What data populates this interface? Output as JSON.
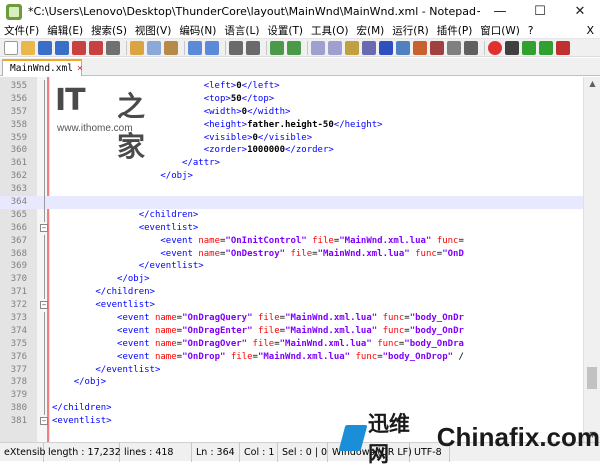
{
  "window": {
    "title": "*C:\\Users\\Lenovo\\Desktop\\ThunderCore\\layout\\MainWnd\\MainWnd.xml - Notepad++",
    "minimize": "—",
    "maximize": "☐",
    "close": "✕"
  },
  "menu": {
    "items": [
      "文件(F)",
      "编辑(E)",
      "搜索(S)",
      "视图(V)",
      "编码(N)",
      "语言(L)",
      "设置(T)",
      "工具(O)",
      "宏(M)",
      "运行(R)",
      "插件(P)",
      "窗口(W)",
      "?"
    ],
    "close": "X"
  },
  "tab": {
    "label": "MainWnd.xml",
    "close": "×"
  },
  "editor": {
    "lines": [
      {
        "n": "355",
        "fold": "",
        "html": "                            <span class=\"tag\">&lt;left&gt;</span><span class=\"txt\">0</span><span class=\"tag\">&lt;/left&gt;</span>"
      },
      {
        "n": "356",
        "fold": "",
        "html": "                            <span class=\"tag\">&lt;top&gt;</span><span class=\"txt\">50</span><span class=\"tag\">&lt;/top&gt;</span>"
      },
      {
        "n": "357",
        "fold": "",
        "html": "                            <span class=\"tag\">&lt;width&gt;</span><span class=\"txt\">0</span><span class=\"tag\">&lt;/width&gt;</span>"
      },
      {
        "n": "358",
        "fold": "",
        "html": "                            <span class=\"tag\">&lt;height&gt;</span><span class=\"txt\">father.height-50</span><span class=\"tag\">&lt;/height&gt;</span>"
      },
      {
        "n": "359",
        "fold": "",
        "html": "                            <span class=\"tag\">&lt;visible&gt;</span><span class=\"txt\">0</span><span class=\"tag\">&lt;/visible&gt;</span>"
      },
      {
        "n": "360",
        "fold": "",
        "html": "                            <span class=\"tag\">&lt;zorder&gt;</span><span class=\"txt\">1000000</span><span class=\"tag\">&lt;/zorder&gt;</span>"
      },
      {
        "n": "361",
        "fold": "",
        "html": "                        <span class=\"tag\">&lt;/attr&gt;</span>"
      },
      {
        "n": "362",
        "fold": "",
        "html": "                    <span class=\"tag\">&lt;/obj&gt;</span>"
      },
      {
        "n": "363",
        "fold": "",
        "html": ""
      },
      {
        "n": "364",
        "fold": "",
        "html": "",
        "current": true
      },
      {
        "n": "365",
        "fold": "",
        "html": "                <span class=\"tag\">&lt;/children&gt;</span>"
      },
      {
        "n": "366",
        "fold": "−",
        "html": "                <span class=\"tag\">&lt;eventlist&gt;</span>"
      },
      {
        "n": "367",
        "fold": "",
        "html": "                    <span class=\"tag\">&lt;event</span> <span class=\"attr\">name</span>=<span class=\"val\">\"OnInitControl\"</span> <span class=\"attr\">file</span>=<span class=\"val\">\"MainWnd.xml.lua\"</span> <span class=\"attr\">func</span>="
      },
      {
        "n": "368",
        "fold": "",
        "html": "                    <span class=\"tag\">&lt;event</span> <span class=\"attr\">name</span>=<span class=\"val\">\"OnDestroy\"</span> <span class=\"attr\">file</span>=<span class=\"val\">\"MainWnd.xml.lua\"</span> <span class=\"attr\">func</span>=<span class=\"val\">\"OnD</span>"
      },
      {
        "n": "369",
        "fold": "",
        "html": "                <span class=\"tag\">&lt;/eventlist&gt;</span>"
      },
      {
        "n": "370",
        "fold": "",
        "html": "            <span class=\"tag\">&lt;/obj&gt;</span>"
      },
      {
        "n": "371",
        "fold": "",
        "html": "        <span class=\"tag\">&lt;/children&gt;</span>"
      },
      {
        "n": "372",
        "fold": "−",
        "html": "        <span class=\"tag\">&lt;eventlist&gt;</span>"
      },
      {
        "n": "373",
        "fold": "",
        "html": "            <span class=\"tag\">&lt;event</span> <span class=\"attr\">name</span>=<span class=\"val\">\"OnDragQuery\"</span> <span class=\"attr\">file</span>=<span class=\"val\">\"MainWnd.xml.lua\"</span> <span class=\"attr\">func</span>=<span class=\"val\">\"body_OnDr</span>"
      },
      {
        "n": "374",
        "fold": "",
        "html": "            <span class=\"tag\">&lt;event</span> <span class=\"attr\">name</span>=<span class=\"val\">\"OnDragEnter\"</span> <span class=\"attr\">file</span>=<span class=\"val\">\"MainWnd.xml.lua\"</span> <span class=\"attr\">func</span>=<span class=\"val\">\"body_OnDr</span>"
      },
      {
        "n": "375",
        "fold": "",
        "html": "            <span class=\"tag\">&lt;event</span> <span class=\"attr\">name</span>=<span class=\"val\">\"OnDragOver\"</span> <span class=\"attr\">file</span>=<span class=\"val\">\"MainWnd.xml.lua\"</span> <span class=\"attr\">func</span>=<span class=\"val\">\"body_OnDra</span>"
      },
      {
        "n": "376",
        "fold": "",
        "html": "            <span class=\"tag\">&lt;event</span> <span class=\"attr\">name</span>=<span class=\"val\">\"OnDrop\"</span> <span class=\"attr\">file</span>=<span class=\"val\">\"MainWnd.xml.lua\"</span> <span class=\"attr\">func</span>=<span class=\"val\">\"body_OnDrop\"</span> /"
      },
      {
        "n": "377",
        "fold": "",
        "html": "        <span class=\"tag\">&lt;/eventlist&gt;</span>"
      },
      {
        "n": "378",
        "fold": "",
        "html": "    <span class=\"tag\">&lt;/obj&gt;</span>"
      },
      {
        "n": "379",
        "fold": "",
        "html": ""
      },
      {
        "n": "380",
        "fold": "",
        "html": "<span class=\"tag\">&lt;/children&gt;</span>"
      },
      {
        "n": "381",
        "fold": "−",
        "html": "<span class=\"tag\">&lt;eventlist&gt;</span>"
      }
    ]
  },
  "status": {
    "lang": "eXtensib",
    "length": "length : 17,232",
    "lines": "lines : 418",
    "ln": "Ln : 364",
    "col": "Col : 1",
    "sel": "Sel : 0 | 0",
    "eol": "Windows (CR LF)",
    "enc": "UTF-8"
  },
  "watermark": {
    "it": "IT",
    "it_cn": "之家",
    "url": "www.ithome.com",
    "cf_cn": "迅维网",
    "cf_en": "Chinafix.com"
  }
}
